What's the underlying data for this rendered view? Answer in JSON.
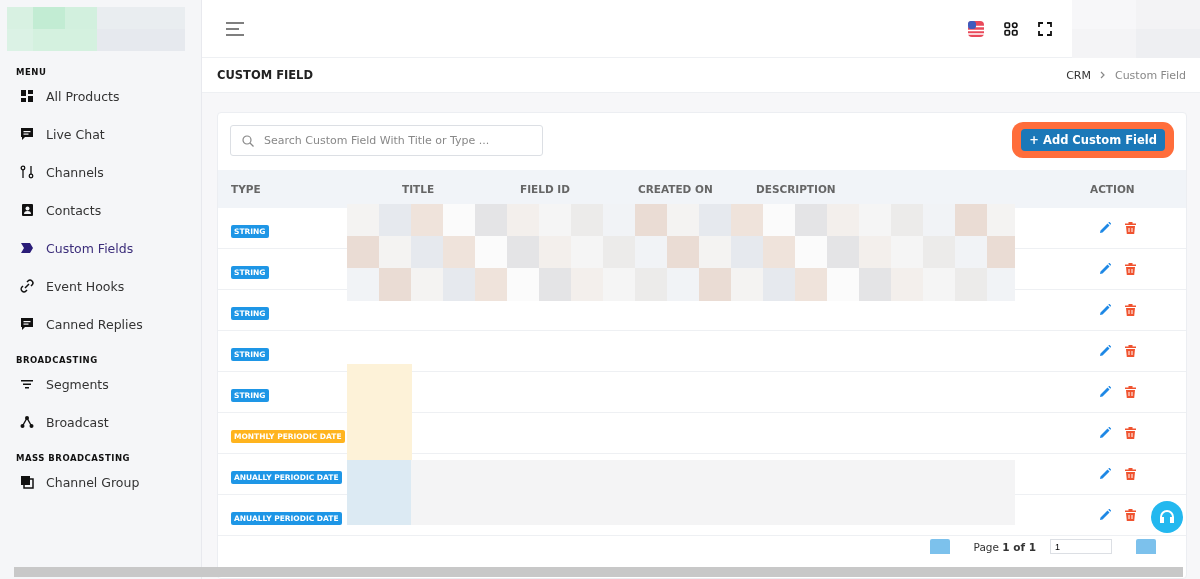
{
  "sidebar": {
    "sections": [
      {
        "title": "MENU",
        "items": [
          {
            "label": "All Products",
            "selected": false
          },
          {
            "label": "Live Chat",
            "selected": false
          },
          {
            "label": "Channels",
            "selected": false
          },
          {
            "label": "Contacts",
            "selected": false
          },
          {
            "label": "Custom Fields",
            "selected": true
          },
          {
            "label": "Event Hooks",
            "selected": false
          },
          {
            "label": "Canned Replies",
            "selected": false
          }
        ]
      },
      {
        "title": "BROADCASTING",
        "items": [
          {
            "label": "Segments",
            "selected": false
          },
          {
            "label": "Broadcast",
            "selected": false
          }
        ]
      },
      {
        "title": "MASS BROADCASTING",
        "items": [
          {
            "label": "Channel Group",
            "selected": false
          }
        ]
      }
    ]
  },
  "page_title": "CUSTOM FIELD",
  "breadcrumb": [
    "CRM",
    "Custom Field"
  ],
  "search": {
    "placeholder": "Search Custom Field With Title or Type ..."
  },
  "add_button": "+ Add Custom Field",
  "table": {
    "columns": [
      "TYPE",
      "TITLE",
      "FIELD ID",
      "CREATED ON",
      "DESCRIPTION",
      "ACTION"
    ],
    "rows": [
      {
        "type": "STRING",
        "color": "#1e96e6"
      },
      {
        "type": "STRING",
        "color": "#1e96e6"
      },
      {
        "type": "STRING",
        "color": "#1e96e6"
      },
      {
        "type": "STRING",
        "color": "#1e96e6"
      },
      {
        "type": "STRING",
        "color": "#1e96e6"
      },
      {
        "type": "MONTHLY PERIODIC DATE",
        "color": "#ffb41e"
      },
      {
        "type": "ANUALLY PERIODIC DATE",
        "color": "#1e96e6"
      },
      {
        "type": "ANUALLY PERIODIC DATE",
        "color": "#1e96e6"
      }
    ]
  },
  "pagination": {
    "text": "Page **1 of 1**",
    "page_value": "1"
  }
}
